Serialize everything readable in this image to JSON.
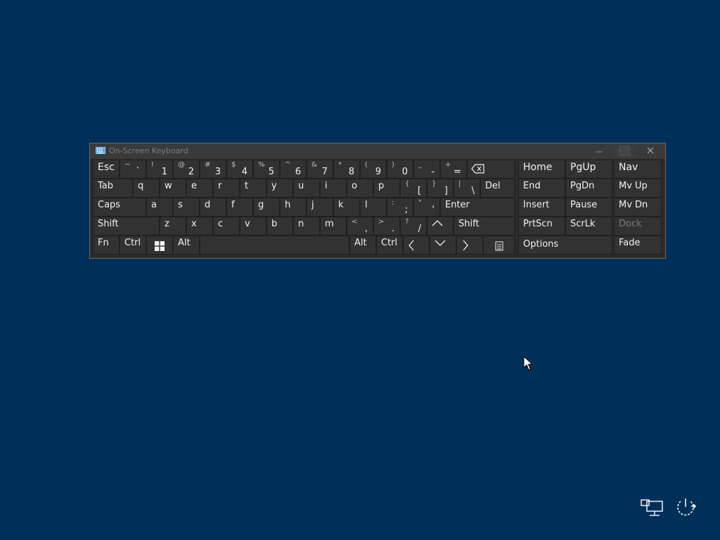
{
  "window": {
    "title": "On-Screen Keyboard"
  },
  "keys": {
    "esc": "Esc",
    "tab": "Tab",
    "caps": "Caps",
    "shift": "Shift",
    "shift_r": "Shift",
    "fn": "Fn",
    "ctrl": "Ctrl",
    "ctrl_r": "Ctrl",
    "alt": "Alt",
    "alt_r": "Alt",
    "del": "Del",
    "enter": "Enter",
    "home": "Home",
    "pgup": "PgUp",
    "nav": "Nav",
    "end": "End",
    "pgdn": "PgDn",
    "mvup": "Mv Up",
    "insert": "Insert",
    "pause": "Pause",
    "mvdn": "Mv Dn",
    "prtscn": "PrtScn",
    "scrlk": "ScrLk",
    "dock": "Dock",
    "options": "Options",
    "fade": "Fade"
  },
  "number_row": [
    {
      "s": "~",
      "m": "`"
    },
    {
      "s": "!",
      "m": "1"
    },
    {
      "s": "@",
      "m": "2"
    },
    {
      "s": "#",
      "m": "3"
    },
    {
      "s": "$",
      "m": "4"
    },
    {
      "s": "%",
      "m": "5"
    },
    {
      "s": "^",
      "m": "6"
    },
    {
      "s": "&",
      "m": "7"
    },
    {
      "s": "*",
      "m": "8"
    },
    {
      "s": "(",
      "m": "9"
    },
    {
      "s": ")",
      "m": "0"
    },
    {
      "s": "_",
      "m": "-"
    },
    {
      "s": "+",
      "m": "="
    }
  ],
  "top_row": [
    "q",
    "w",
    "e",
    "r",
    "t",
    "y",
    "u",
    "i",
    "o",
    "p"
  ],
  "top_row_sym": [
    {
      "s": "{",
      "m": "["
    },
    {
      "s": "}",
      "m": "]"
    },
    {
      "s": "|",
      "m": "\\"
    }
  ],
  "home_row": [
    "a",
    "s",
    "d",
    "f",
    "g",
    "h",
    "j",
    "k",
    "l"
  ],
  "home_row_sym": [
    {
      "s": ":",
      "m": ";"
    },
    {
      "s": "\"",
      "m": "'"
    }
  ],
  "bottom_row": [
    "z",
    "x",
    "c",
    "v",
    "b",
    "n",
    "m"
  ],
  "bottom_row_sym": [
    {
      "s": "<",
      "m": ","
    },
    {
      "s": ">",
      "m": "."
    },
    {
      "s": "?",
      "m": "/"
    }
  ],
  "icons": {
    "window": "keyboard-icon",
    "backspace": "backspace-icon",
    "windows": "windows-logo-icon",
    "up": "arrow-up-icon",
    "down": "arrow-down-icon",
    "left": "arrow-left-icon",
    "right": "arrow-right-icon",
    "menu": "context-menu-icon",
    "network": "network-icon",
    "power": "power-icon",
    "cursor": "mouse-pointer-icon"
  },
  "colors": {
    "desktop": "#00305a",
    "key": "#323232",
    "frame": "#2b2b2b",
    "text": "#f2f2f2"
  }
}
